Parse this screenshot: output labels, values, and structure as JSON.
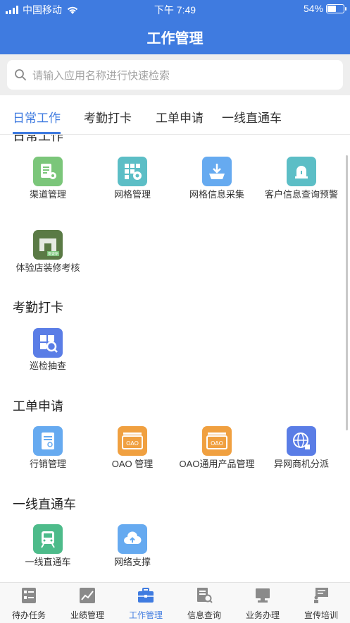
{
  "status_bar": {
    "carrier": "中国移动",
    "time": "下午 7:49",
    "battery": "54%",
    "battery_level": 0.54
  },
  "header": {
    "title": "工作管理"
  },
  "search": {
    "placeholder": "请输入应用名称进行快速检索"
  },
  "tabs": [
    {
      "label": "日常工作",
      "active": true
    },
    {
      "label": "考勤打卡",
      "active": false
    },
    {
      "label": "工单申请",
      "active": false
    },
    {
      "label": "一线直通车",
      "active": false
    }
  ],
  "sections": {
    "daily": {
      "title": "日常工作",
      "items": [
        "渠道管理",
        "网格管理",
        "网格信息采集",
        "客户信息查询预警",
        "体验店装修考核"
      ]
    },
    "attendance": {
      "title": "考勤打卡",
      "items": [
        "巡检抽查"
      ]
    },
    "workorder": {
      "title": "工单申请",
      "items": [
        "行销管理",
        "OAO 管理",
        "OAO通用产品管理",
        "异网商机分派"
      ]
    },
    "direct": {
      "title": "一线直通车",
      "items": [
        "一线直通车",
        "网络支撑"
      ]
    }
  },
  "icon_labels": {
    "oao": "OAO",
    "pending": "需更新"
  },
  "bottom_nav": [
    {
      "label": "待办任务",
      "icon": "task-list-icon"
    },
    {
      "label": "业绩管理",
      "icon": "chart-icon"
    },
    {
      "label": "工作管理",
      "icon": "briefcase-icon",
      "active": true
    },
    {
      "label": "信息查询",
      "icon": "doc-search-icon"
    },
    {
      "label": "业务办理",
      "icon": "computer-icon"
    },
    {
      "label": "宣传培训",
      "icon": "presentation-icon"
    }
  ],
  "colors": {
    "primary": "#3f7be0",
    "green": "#7bc67a",
    "teal": "#5cbec6",
    "sky": "#66aaf0",
    "orange": "#f0a040",
    "indigo": "#5a7de6",
    "olive": "#5a7a45"
  }
}
